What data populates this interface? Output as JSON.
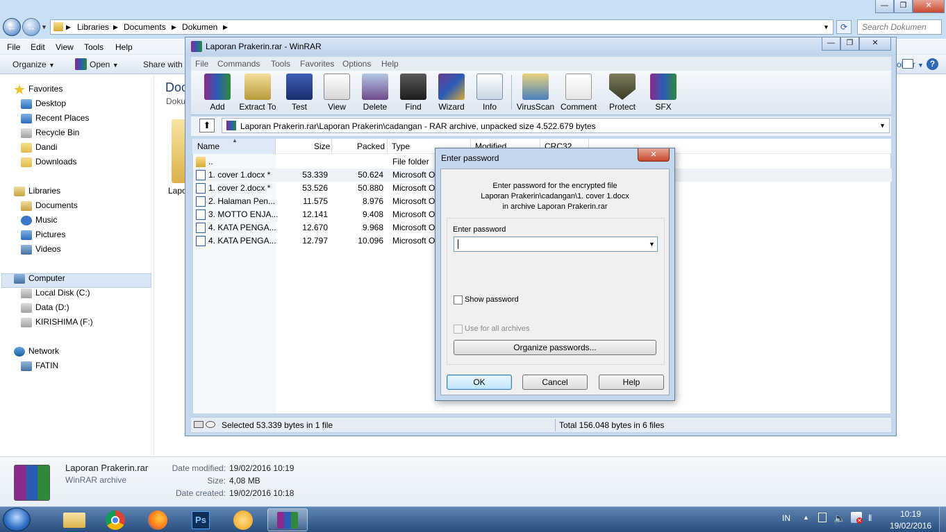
{
  "explorer": {
    "breadcrumb": [
      "Libraries",
      "Documents",
      "Dokumen"
    ],
    "search_placeholder": "Search Dokumen",
    "menu": [
      "File",
      "Edit",
      "View",
      "Tools",
      "Help"
    ],
    "commands": {
      "organize": "Organize",
      "open": "Open",
      "share": "Share with",
      "folder_menu": "older"
    },
    "content_title": "Doc",
    "content_sub": "Doku",
    "content_folder_label": "Lapo",
    "nav": {
      "favorites": "Favorites",
      "favorites_items": [
        "Desktop",
        "Recent Places",
        "Recycle Bin",
        "Dandi",
        "Downloads"
      ],
      "libraries": "Libraries",
      "libraries_items": [
        "Documents",
        "Music",
        "Pictures",
        "Videos"
      ],
      "computer": "Computer",
      "computer_items": [
        "Local Disk (C:)",
        "Data (D:)",
        "KIRISHIMA (F:)"
      ],
      "network": "Network",
      "network_items": [
        "FATIN"
      ]
    },
    "details": {
      "name": "Laporan Prakerin.rar",
      "type": "WinRAR archive",
      "modified_label": "Date modified:",
      "modified_value": "19/02/2016 10:19",
      "size_label": "Size:",
      "size_value": "4,08 MB",
      "created_label": "Date created:",
      "created_value": "19/02/2016 10:18"
    }
  },
  "winrar": {
    "title": "Laporan Prakerin.rar - WinRAR",
    "menu": [
      "File",
      "Commands",
      "Tools",
      "Favorites",
      "Options",
      "Help"
    ],
    "toolbar": [
      "Add",
      "Extract To",
      "Test",
      "View",
      "Delete",
      "Find",
      "Wizard",
      "Info",
      "VirusScan",
      "Comment",
      "Protect",
      "SFX"
    ],
    "path": "Laporan Prakerin.rar\\Laporan Prakerin\\cadangan - RAR archive, unpacked size 4.522.679 bytes",
    "columns": [
      "Name",
      "Size",
      "Packed",
      "Type",
      "Modified",
      "CRC32"
    ],
    "files": [
      {
        "name": "..",
        "size": "",
        "packed": "",
        "type": "File folder"
      },
      {
        "name": "1. cover 1.docx *",
        "size": "53.339",
        "packed": "50.624",
        "type": "Microsoft O"
      },
      {
        "name": "1. cover 2.docx *",
        "size": "53.526",
        "packed": "50.880",
        "type": "Microsoft O"
      },
      {
        "name": "2. Halaman Pen...",
        "size": "11.575",
        "packed": "8.976",
        "type": "Microsoft O"
      },
      {
        "name": "3. MOTTO ENJA...",
        "size": "12.141",
        "packed": "9.408",
        "type": "Microsoft O"
      },
      {
        "name": "4. KATA PENGA...",
        "size": "12.670",
        "packed": "9.968",
        "type": "Microsoft O"
      },
      {
        "name": "4. KATA PENGA...",
        "size": "12.797",
        "packed": "10.096",
        "type": "Microsoft O"
      }
    ],
    "status_left": "Selected 53.339 bytes in 1 file",
    "status_right": "Total 156.048 bytes in 6 files"
  },
  "password_dialog": {
    "title": "Enter password",
    "message_line1": "Enter password for the encrypted file",
    "message_line2": "Laporan Prakerin\\cadangan\\1. cover 1.docx",
    "message_line3": "in archive Laporan Prakerin.rar",
    "field_label": "Enter password",
    "password_value": "",
    "show_password": "Show password",
    "use_for_all": "Use for all archives",
    "organize_button": "Organize passwords...",
    "ok": "OK",
    "cancel": "Cancel",
    "help": "Help"
  },
  "taskbar": {
    "lang": "IN",
    "time": "10:19",
    "date": "19/02/2016",
    "ps_label": "Ps"
  }
}
